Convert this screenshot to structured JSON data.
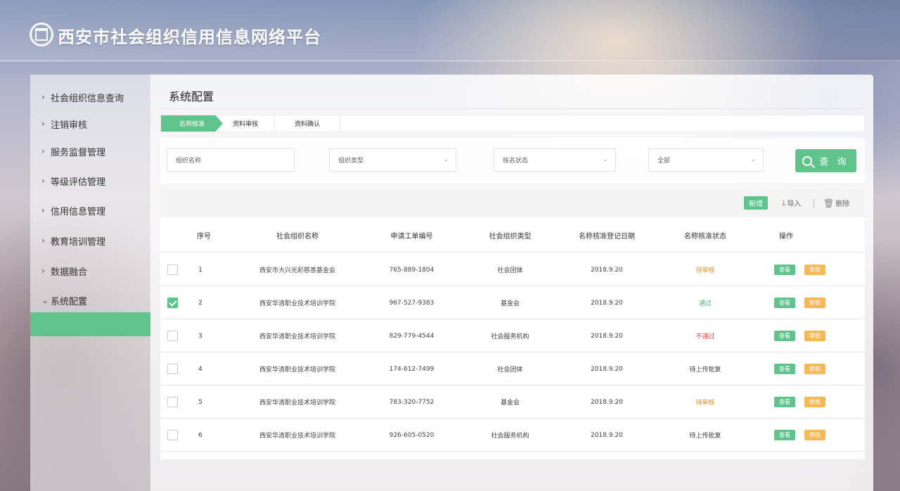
{
  "app": {
    "title": "西安市社会组织信用信息网络平台"
  },
  "sidebar": {
    "items": [
      {
        "label": "社会组织信息查询"
      },
      {
        "label": "注销审核"
      },
      {
        "label": "服务监督管理"
      },
      {
        "label": "等级评估管理"
      },
      {
        "label": "信用信息管理"
      },
      {
        "label": "教育培训管理"
      },
      {
        "label": "数据融合"
      },
      {
        "label": "系统配置"
      }
    ]
  },
  "page": {
    "title": "系统配置"
  },
  "tabs": [
    {
      "label": "名称核准",
      "active": true
    },
    {
      "label": "资料审核",
      "active": false
    },
    {
      "label": "资料确认",
      "active": false
    }
  ],
  "filters": {
    "org_name_placeholder": "组织名称",
    "org_type_placeholder": "组织类型",
    "status_placeholder": "核名状态",
    "scope_value": "全部",
    "search_label": "查 询"
  },
  "toolbar": {
    "new_label": "新增",
    "import_label": "导入",
    "delete_label": "删除"
  },
  "table": {
    "headers": {
      "index": "序号",
      "org_name": "社会组织名称",
      "order_no": "申请工单编号",
      "org_type": "社会组织类型",
      "reg_date": "名称核准登记日期",
      "status": "名称核准状态",
      "action": "操作"
    },
    "action_view": "查看",
    "action_audit": "审核",
    "rows": [
      {
        "checked": false,
        "index": "1",
        "org_name": "西安市大兴光彩慈善基金会",
        "order_no": "765-889-1804",
        "org_type": "社会团体",
        "reg_date": "2018.9.20",
        "status": "待审核",
        "status_color": "#f08c1a"
      },
      {
        "checked": true,
        "index": "2",
        "org_name": "西安华清职业技术培训学院",
        "order_no": "967-527-9383",
        "org_type": "基金会",
        "reg_date": "2018.9.20",
        "status": "通过",
        "status_color": "#3fb871"
      },
      {
        "checked": false,
        "index": "3",
        "org_name": "西安华清职业技术培训学院",
        "order_no": "829-779-4544",
        "org_type": "社会服务机构",
        "reg_date": "2018.9.20",
        "status": "不通过",
        "status_color": "#e84545"
      },
      {
        "checked": false,
        "index": "4",
        "org_name": "西安华清职业技术培训学院",
        "order_no": "174-612-7499",
        "org_type": "社会团体",
        "reg_date": "2018.9.20",
        "status": "待上传批复",
        "status_color": "#444444"
      },
      {
        "checked": false,
        "index": "5",
        "org_name": "西安华清职业技术培训学院",
        "order_no": "783-320-7752",
        "org_type": "基金会",
        "reg_date": "2018.9.20",
        "status": "待审核",
        "status_color": "#f08c1a"
      },
      {
        "checked": false,
        "index": "6",
        "org_name": "西安华清职业技术培训学院",
        "order_no": "926-605-0520",
        "org_type": "社会服务机构",
        "reg_date": "2018.9.20",
        "status": "待上传批复",
        "status_color": "#444444"
      }
    ]
  }
}
